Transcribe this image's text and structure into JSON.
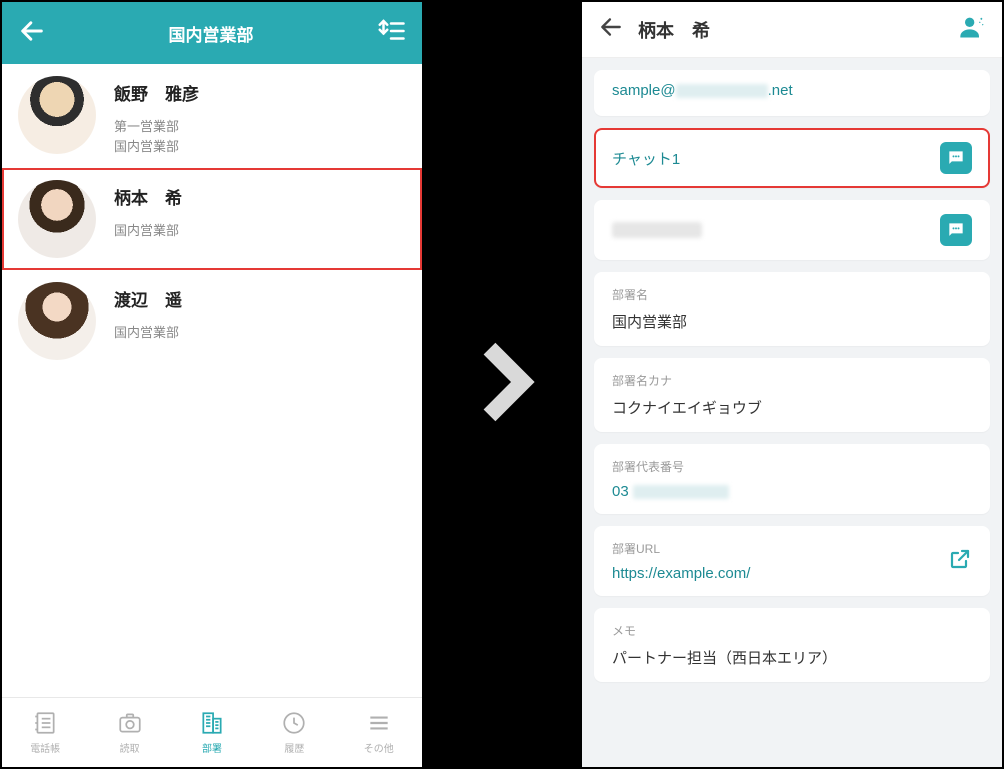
{
  "left": {
    "title": "国内営業部",
    "contacts": [
      {
        "name": "飯野　雅彦",
        "sub1": "第一営業部",
        "sub2": "国内営業部"
      },
      {
        "name": "柄本　希",
        "sub1": "国内営業部",
        "sub2": ""
      },
      {
        "name": "渡辺　遥",
        "sub1": "国内営業部",
        "sub2": ""
      }
    ],
    "nav": [
      {
        "label": "電話帳"
      },
      {
        "label": "読取"
      },
      {
        "label": "部署"
      },
      {
        "label": "履歴"
      },
      {
        "label": "その他"
      }
    ]
  },
  "right": {
    "title": "柄本　希",
    "email_prefix": "sample@",
    "email_suffix": ".net",
    "chat1": "チャット1",
    "dept_name_label": "部署名",
    "dept_name": "国内営業部",
    "dept_kana_label": "部署名カナ",
    "dept_kana": "コクナイエイギョウブ",
    "dept_phone_label": "部署代表番号",
    "dept_phone_prefix": "03",
    "dept_url_label": "部署URL",
    "dept_url": "https://example.com/",
    "memo_label": "メモ",
    "memo": "パートナー担当（西日本エリア）"
  }
}
